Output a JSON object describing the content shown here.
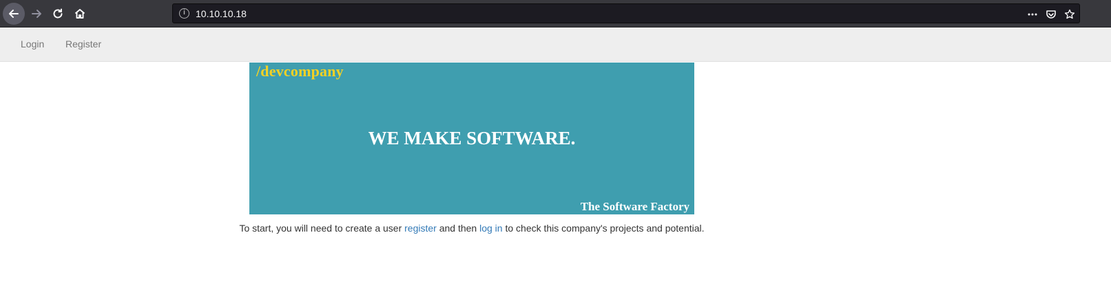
{
  "browser": {
    "url": "10.10.10.18",
    "icons": {
      "back": "back-arrow-icon",
      "forward": "forward-arrow-icon",
      "reload": "reload-icon",
      "home": "home-icon",
      "info": "info-icon",
      "more": "more-actions-icon",
      "pocket": "pocket-icon",
      "bookmark": "star-icon"
    }
  },
  "nav": {
    "login": "Login",
    "register": "Register"
  },
  "banner": {
    "brand": "/devcompany",
    "headline": "WE MAKE SOFTWARE.",
    "tagline": "The Software Factory",
    "background": "#3f9eaf",
    "brand_color": "#f2d125"
  },
  "intro": {
    "before": "To start, you will need to create a user ",
    "register_link": "register",
    "middle": " and then ",
    "login_link": "log in",
    "after": " to check this company's projects and potential."
  },
  "colors": {
    "link": "#337ab7",
    "nav_text": "#777777",
    "navbar_bg": "#eeeeee"
  }
}
